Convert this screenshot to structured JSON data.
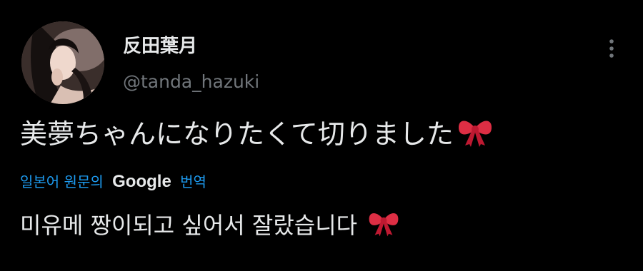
{
  "author": {
    "display_name": "反田葉月",
    "handle": "@tanda_hazuki"
  },
  "tweet": {
    "text": "美夢ちゃんになりたくて切りました",
    "trailing_emoji": "ribbon-bow"
  },
  "translation": {
    "prefix": "일본어 원문의",
    "provider": "Google",
    "suffix": "번역",
    "text": "미유메 짱이되고 싶어서 잘랐습니다",
    "trailing_emoji": "ribbon-bow"
  },
  "colors": {
    "background": "#000000",
    "text_primary": "#e7e9ea",
    "text_secondary": "#71767b",
    "link_blue": "#1d9bf0",
    "ribbon_red": "#dd2e44"
  },
  "icons": {
    "more": "more-vertical-icon",
    "emoji": "ribbon-icon"
  }
}
